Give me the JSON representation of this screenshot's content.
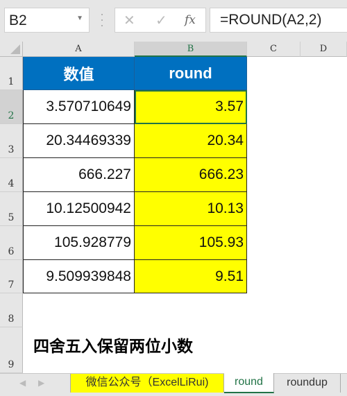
{
  "name_box": "B2",
  "formula": "=ROUND(A2,2)",
  "formula_icons": {
    "cancel": "✕",
    "enter": "✓",
    "fx": "fx"
  },
  "columns": [
    "A",
    "B",
    "C",
    "D"
  ],
  "rows": [
    "1",
    "2",
    "3",
    "4",
    "5",
    "6",
    "7",
    "8",
    "9"
  ],
  "headers": [
    "数值",
    "round"
  ],
  "data": [
    [
      "3.570710649",
      "3.57"
    ],
    [
      "20.34469339",
      "20.34"
    ],
    [
      "666.227",
      "666.23"
    ],
    [
      "10.12500942",
      "10.13"
    ],
    [
      "105.928779",
      "105.93"
    ],
    [
      "9.509939848",
      "9.51"
    ]
  ],
  "note": "四舍五入保留两位小数",
  "sheet_tabs": [
    "微信公众号（ExcelLiRui)",
    "round",
    "roundup"
  ],
  "active_tab": "round",
  "colors": {
    "header_fill": "#0070c0",
    "highlight": "#ffff00",
    "selection": "#217346"
  }
}
